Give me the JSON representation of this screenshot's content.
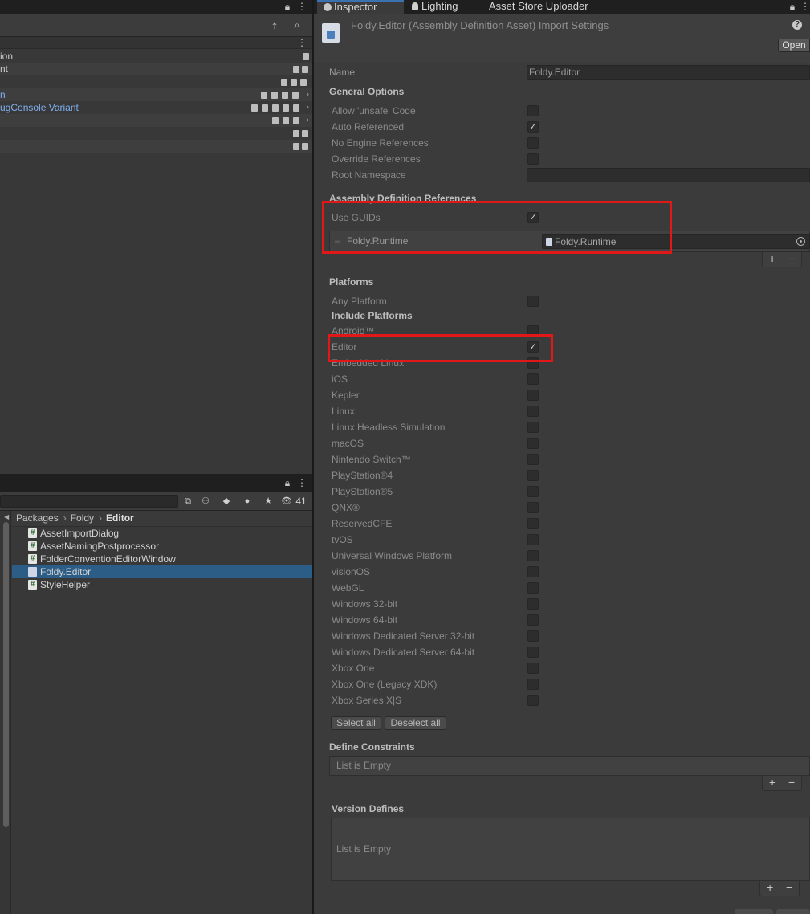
{
  "hierarchy": {
    "rows": [
      {
        "text": "ion",
        "blue": false
      },
      {
        "text": "nt",
        "blue": false
      },
      {
        "text": "",
        "blue": false
      },
      {
        "text": "n",
        "blue": true
      },
      {
        "text": "ugConsole Variant",
        "blue": true
      },
      {
        "text": "",
        "blue": false
      },
      {
        "text": "",
        "blue": false
      },
      {
        "text": "",
        "blue": false
      }
    ]
  },
  "project": {
    "breadcrumb": [
      "Packages",
      "Foldy",
      "Editor"
    ],
    "eye_count": "41",
    "files": [
      {
        "name": "AssetImportDialog",
        "icon": "#",
        "kind": "script"
      },
      {
        "name": "AssetNamingPostprocessor",
        "icon": "#",
        "kind": "script"
      },
      {
        "name": "FolderConventionEditorWindow",
        "icon": "#",
        "kind": "script"
      },
      {
        "name": "Foldy.Editor",
        "icon": "",
        "kind": "assembly"
      },
      {
        "name": "StyleHelper",
        "icon": "#",
        "kind": "script"
      }
    ],
    "selected_index": 3
  },
  "inspector": {
    "tabs": [
      "Inspector",
      "Lighting",
      "Asset Store Uploader"
    ],
    "active_tab": 0,
    "header_title": "Foldy.Editor (Assembly Definition Asset) Import Settings",
    "help_glyph": "?",
    "open_label": "Open",
    "name_label": "Name",
    "name_value": "Foldy.Editor",
    "general_options": {
      "title": "General Options",
      "items": [
        {
          "label": "Allow 'unsafe' Code",
          "checked": false
        },
        {
          "label": "Auto Referenced",
          "checked": true
        },
        {
          "label": "No Engine References",
          "checked": false
        },
        {
          "label": "Override References",
          "checked": false
        }
      ],
      "root_namespace_label": "Root Namespace",
      "root_namespace_value": ""
    },
    "assembly_refs": {
      "title": "Assembly Definition References",
      "use_guids_label": "Use GUIDs",
      "use_guids_checked": true,
      "item_label": "Foldy.Runtime",
      "item_value": "Foldy.Runtime"
    },
    "platforms": {
      "title": "Platforms",
      "any_platform_label": "Any Platform",
      "any_platform_checked": false,
      "include_label": "Include Platforms",
      "items": [
        {
          "label": "Android™",
          "checked": false
        },
        {
          "label": "Editor",
          "checked": true
        },
        {
          "label": "Embedded Linux",
          "checked": false
        },
        {
          "label": "iOS",
          "checked": false
        },
        {
          "label": "Kepler",
          "checked": false
        },
        {
          "label": "Linux",
          "checked": false
        },
        {
          "label": "Linux Headless Simulation",
          "checked": false
        },
        {
          "label": "macOS",
          "checked": false
        },
        {
          "label": "Nintendo Switch™",
          "checked": false
        },
        {
          "label": "PlayStation®4",
          "checked": false
        },
        {
          "label": "PlayStation®5",
          "checked": false
        },
        {
          "label": "QNX®",
          "checked": false
        },
        {
          "label": "ReservedCFE",
          "checked": false
        },
        {
          "label": "tvOS",
          "checked": false
        },
        {
          "label": "Universal Windows Platform",
          "checked": false
        },
        {
          "label": "visionOS",
          "checked": false
        },
        {
          "label": "WebGL",
          "checked": false
        },
        {
          "label": "Windows 32-bit",
          "checked": false
        },
        {
          "label": "Windows 64-bit",
          "checked": false
        },
        {
          "label": "Windows Dedicated Server 32-bit",
          "checked": false
        },
        {
          "label": "Windows Dedicated Server 64-bit",
          "checked": false
        },
        {
          "label": "Xbox One",
          "checked": false
        },
        {
          "label": "Xbox One (Legacy XDK)",
          "checked": false
        },
        {
          "label": "Xbox Series X|S",
          "checked": false
        }
      ],
      "select_all_label": "Select all",
      "deselect_all_label": "Deselect all"
    },
    "define_constraints": {
      "title": "Define Constraints",
      "empty_text": "List is Empty"
    },
    "version_defines": {
      "title": "Version Defines",
      "empty_text": "List is Empty"
    },
    "plus_glyph": "+",
    "minus_glyph": "−",
    "checkmark_glyph": "✓"
  },
  "colors": {
    "highlight": "#e01818",
    "selection": "#2c5d87",
    "link_blue": "#7fb0f0",
    "tab_accent": "#3a72b0"
  }
}
